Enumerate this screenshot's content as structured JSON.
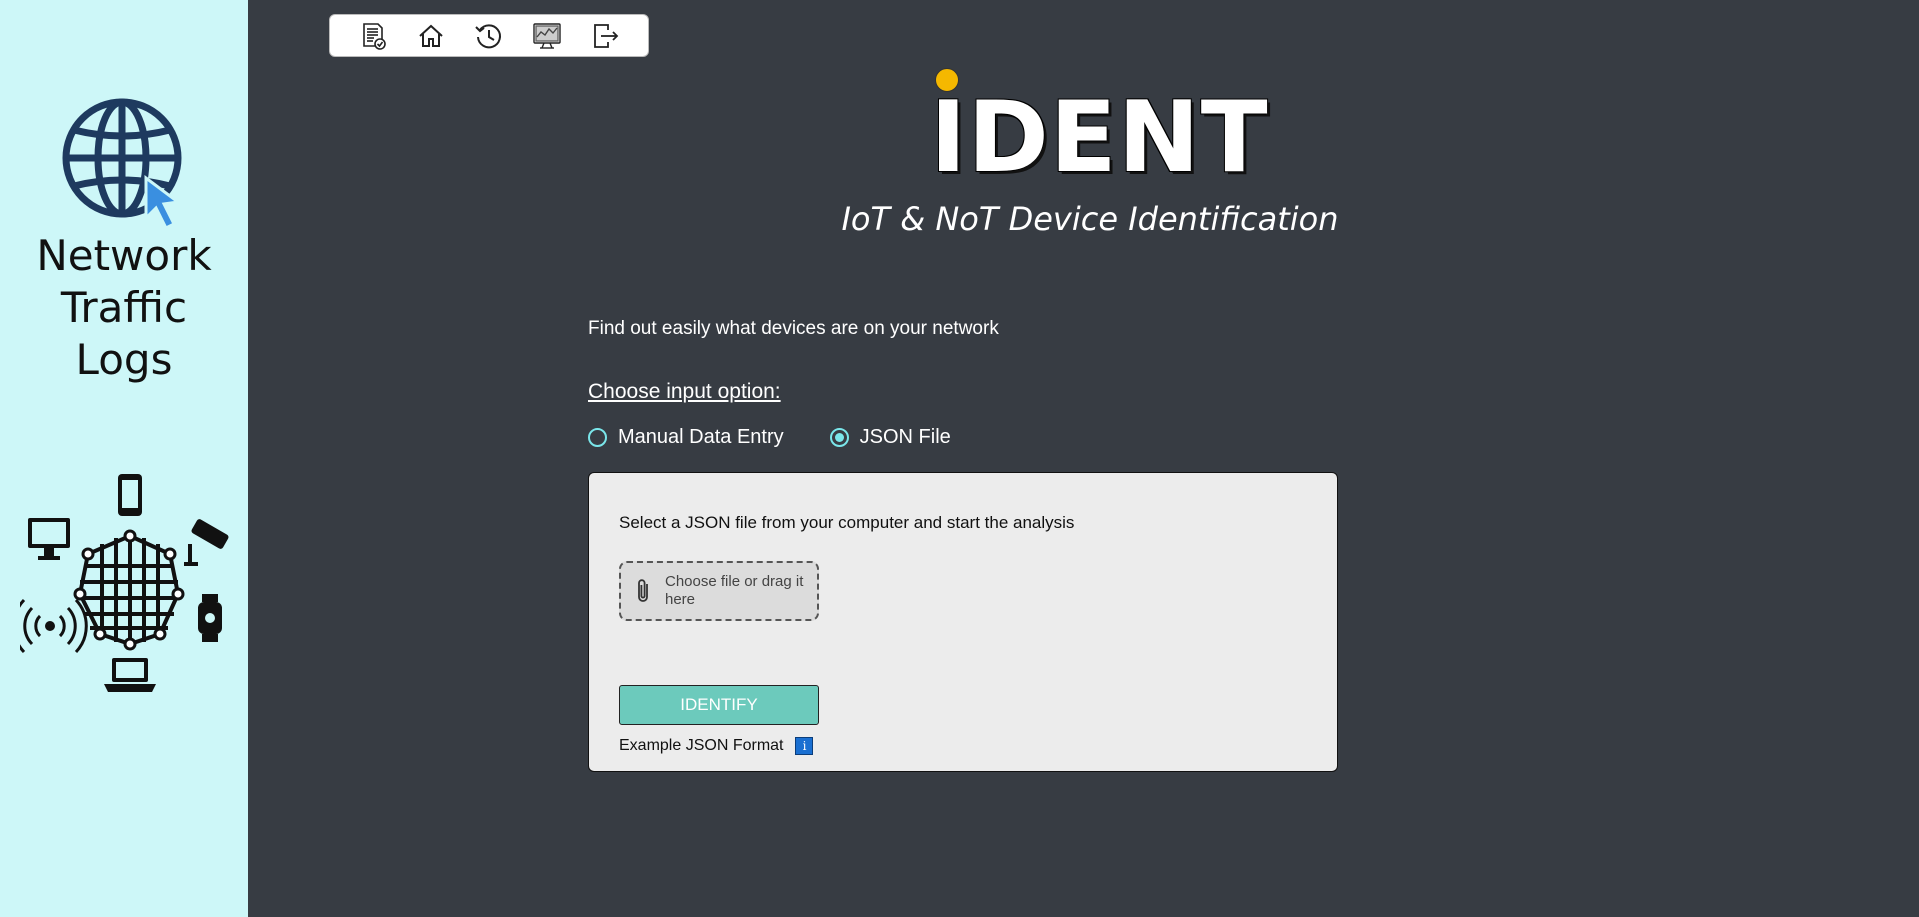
{
  "sidebar": {
    "title_line1": "Network",
    "title_line2": "Traffic",
    "title_line3": "Logs"
  },
  "toolbar": {
    "items": [
      {
        "icon": "report-icon"
      },
      {
        "icon": "home-icon"
      },
      {
        "icon": "history-icon"
      },
      {
        "icon": "monitor-dashboard-icon"
      },
      {
        "icon": "logout-icon"
      }
    ]
  },
  "header": {
    "logo_text": "IDENT",
    "subtitle": "IoT & NoT Device Identification"
  },
  "main": {
    "intro": "Find out easily what devices are on your network",
    "choose_label": "Choose input option:",
    "options": [
      {
        "label": "Manual Data Entry",
        "checked": false
      },
      {
        "label": "JSON File",
        "checked": true
      }
    ],
    "panel": {
      "instruction": "Select a JSON file from your computer and start the analysis",
      "file_drop_label": "Choose file or drag it here",
      "identify_label": "IDENTIFY",
      "example_label": "Example JSON Format",
      "info_label": "i"
    }
  },
  "colors": {
    "sidebar_bg": "#cdf7f8",
    "main_bg": "#373c43",
    "accent": "#7ae6ea",
    "button": "#6ccabc",
    "logo_dot": "#f5b800"
  }
}
